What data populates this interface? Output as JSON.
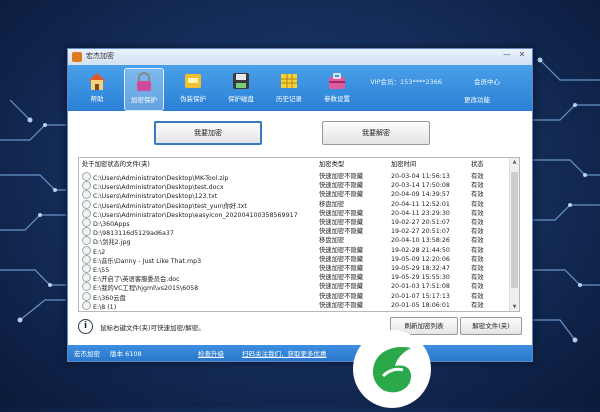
{
  "window": {
    "title": "宏杰加密",
    "minimize": "—",
    "close": "✕"
  },
  "toolbar": {
    "items": [
      {
        "label": "帮助",
        "icon": "house-icon"
      },
      {
        "label": "加密保护",
        "icon": "padlock-icon"
      },
      {
        "label": "伪装保护",
        "icon": "mask-card-icon"
      },
      {
        "label": "保护磁盘",
        "icon": "disk-icon"
      },
      {
        "label": "历史记录",
        "icon": "history-grid-icon"
      },
      {
        "label": "参数设置",
        "icon": "toolbox-icon"
      }
    ],
    "vip": "VIP会员：153****2366",
    "user_center": "会员中心",
    "change_pwd": "更改功能"
  },
  "actions": {
    "encrypt": "我要加密",
    "decrypt": "我要解密"
  },
  "list": {
    "headers": [
      "处于加密状态的文件(夹)",
      "加密类型",
      "加密时间",
      "状态"
    ],
    "rows": [
      [
        "C:\\Users\\Administrator\\Desktop\\MK-Tool.zip",
        "快速加密不隐藏",
        "20-03-04 11:56:13",
        "有效"
      ],
      [
        "C:\\Users\\Administrator\\Desktop\\test.docx",
        "快速加密不隐藏",
        "20-03-14 17:50:08",
        "有效"
      ],
      [
        "C:\\Users\\Administrator\\Desktop\\123.txt",
        "快速加密不隐藏",
        "20-04-09 14:39:57",
        "有效"
      ],
      [
        "C:\\Users\\Administrator\\Desktop\\test_yun\\你好.txt",
        "移盘加密",
        "20-04-11 12:52:01",
        "有效"
      ],
      [
        "C:\\Users\\Administrator\\Desktop\\easyicon_20200410035856991​7",
        "快速加密不隐藏",
        "20-04-11 23:29:30",
        "有效"
      ],
      [
        "D:\\360Apps",
        "快速加密不隐藏",
        "19-02-27 20:51:07",
        "有效"
      ],
      [
        "D:\\9813116d5129ad6a37",
        "快速加密不隐藏",
        "19-02-27 20:51:07",
        "有效"
      ],
      [
        "D:\\剑兆2.jpg",
        "移盘加密",
        "20-04-10 13:58:26",
        "有效"
      ],
      [
        "E:\\2",
        "快速加密不隐藏",
        "19-02-28 21:44:50",
        "有效"
      ],
      [
        "E:\\音乐\\Danny - Just Like That.mp3",
        "快速加密不隐藏",
        "19-05-09 12:20:06",
        "有效"
      ],
      [
        "E:\\55",
        "快速加密不隐藏",
        "19-05-29 18:32:47",
        "有效"
      ],
      [
        "E:\\开启了\\英语客服委员会.doc",
        "快速加密不隐藏",
        "19-05-29 15:55:30",
        "有效"
      ],
      [
        "E:\\我的VC工程\\hjgml\\vs2015\\6058",
        "快速加密不隐藏",
        "20-01-03 17:51:08",
        "有效"
      ],
      [
        "E:\\360云盘",
        "快速加密不隐藏",
        "20-01-07 15:17:13",
        "有效"
      ],
      [
        "E:\\8 (1)",
        "快速加密不隐藏",
        "20-01-05 18:06:01",
        "有效"
      ]
    ]
  },
  "footer": {
    "info_icon": "i",
    "hint": "鼠标右键文件(夹)可快速加密/解密。",
    "refresh": "刷新加密列表",
    "decrypt_file": "解密文件(夹)"
  },
  "statusbar": {
    "app": "宏杰加密",
    "version": "版本 6108",
    "check_update": "检查升级",
    "promo": "扫码关注我们，获取更多优惠"
  },
  "colors": {
    "accent": "#2a80d6",
    "logo_green": "#2aa84a"
  }
}
